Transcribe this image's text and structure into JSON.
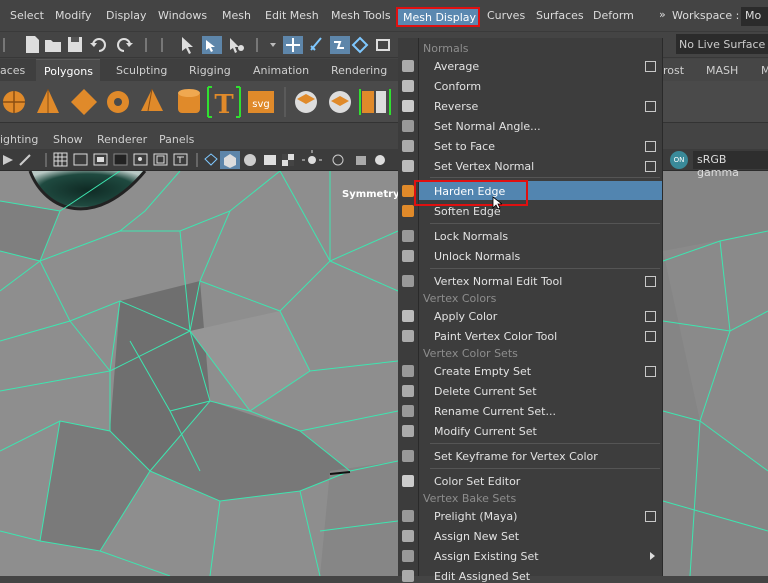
{
  "menubar": {
    "items": [
      "Select",
      "Modify",
      "Display",
      "Windows",
      "Mesh",
      "Edit Mesh",
      "Mesh Tools",
      "Mesh Display",
      "Curves",
      "Surfaces",
      "Deform"
    ],
    "overflow": "»",
    "workspace_label": "Workspace :",
    "workspace_value": "Mo"
  },
  "toolbar": {
    "live_surface": "No Live Surface"
  },
  "shelf_tabs": [
    "aces",
    "Polygons",
    "Sculpting",
    "Rigging",
    "Animation",
    "Rendering"
  ],
  "shelf_tabs_right": [
    "rost",
    "MASH",
    "M"
  ],
  "panel_menu": [
    "ighting",
    "Show",
    "Renderer",
    "Panels"
  ],
  "viewport": {
    "symmetry": "Symmetry:",
    "color_space": "sRGB gamma",
    "color_mgmt_badge": "ON"
  },
  "shelf_labels": {
    "text_tool": "T",
    "svg_tool": "svg"
  },
  "menu": {
    "sections": {
      "normals": "Normals",
      "vertex_colors": "Vertex Colors",
      "vertex_color_sets": "Vertex Color Sets",
      "vertex_bake_sets": "Vertex Bake Sets"
    },
    "items": {
      "average": "Average",
      "conform": "Conform",
      "reverse": "Reverse",
      "set_normal_angle": "Set Normal Angle...",
      "set_to_face": "Set to Face",
      "set_vertex_normal": "Set Vertex Normal",
      "harden_edge": "Harden Edge",
      "soften_edge": "Soften Edge",
      "lock_normals": "Lock Normals",
      "unlock_normals": "Unlock Normals",
      "vertex_normal_edit_tool": "Vertex Normal Edit Tool",
      "apply_color": "Apply Color",
      "paint_vertex_color_tool": "Paint Vertex Color Tool",
      "create_empty_set": "Create Empty Set",
      "delete_current_set": "Delete Current Set",
      "rename_current_set": "Rename Current Set...",
      "modify_current_set": "Modify Current Set",
      "set_keyframe_vertex_color": "Set Keyframe for Vertex Color",
      "color_set_editor": "Color Set Editor",
      "prelight_maya": "Prelight (Maya)",
      "assign_new_set": "Assign New Set",
      "assign_existing_set": "Assign Existing Set",
      "edit_assigned_set": "Edit Assigned Set"
    }
  },
  "colors": {
    "highlight": "#5285b0",
    "accent_red": "#e01010",
    "wire": "#3de6b0",
    "shelf_orange": "#e08a2a"
  }
}
